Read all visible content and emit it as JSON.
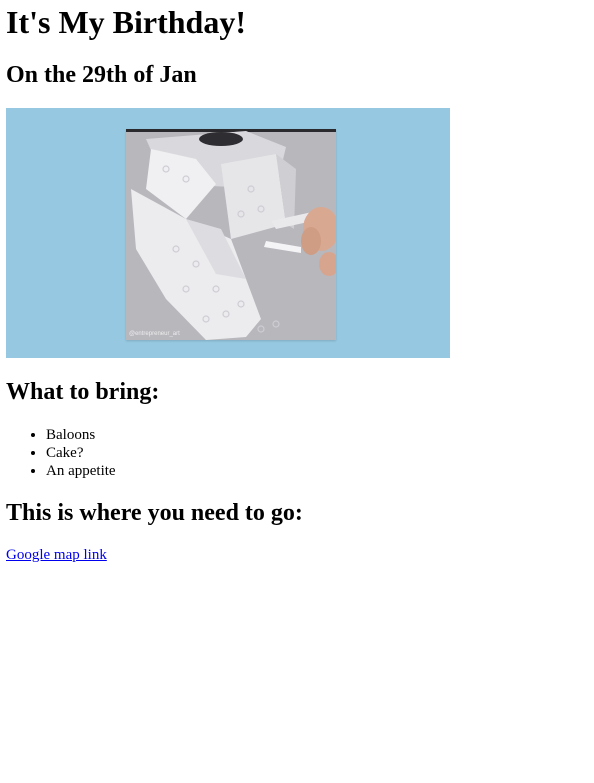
{
  "page": {
    "title": "It's My Birthday!",
    "date": "On the 29th of Jan"
  },
  "banner": {
    "background_color": "#96c8e1",
    "image": {
      "description_icon": "toilet-paper-tie-gif",
      "watermark": "@entrepreneur_art"
    }
  },
  "bring": {
    "heading": "What to bring:",
    "items": [
      "Baloons",
      "Cake?",
      "An appetite"
    ]
  },
  "location": {
    "heading": "This is where you need to go:",
    "link_text": "Google map link",
    "link_color": "#0000ee"
  }
}
